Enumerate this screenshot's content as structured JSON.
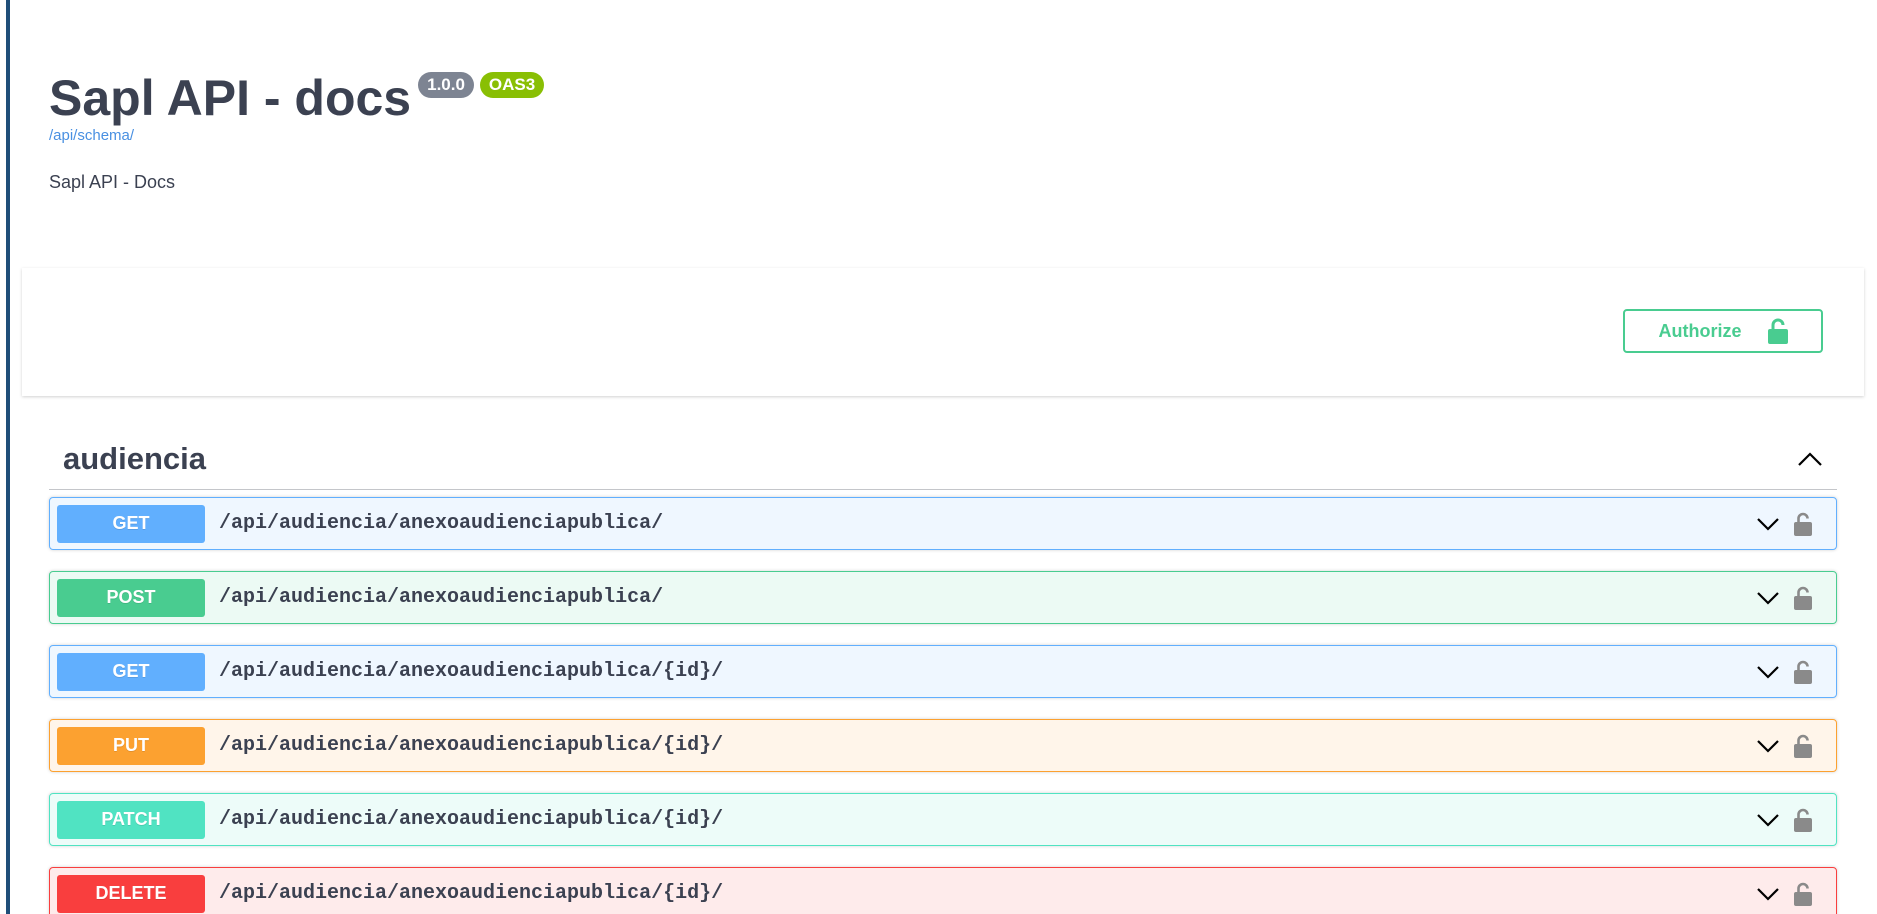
{
  "info": {
    "title": "Sapl API - docs",
    "version": "1.0.0",
    "oas_badge": "OAS3",
    "schema_url": "/api/schema/",
    "description": "Sapl API - Docs"
  },
  "authorize": {
    "label": "Authorize",
    "icon": "unlocked-padlock-icon",
    "color": "#49cc90"
  },
  "tag": {
    "name": "audiencia",
    "expanded": true
  },
  "operations": [
    {
      "method": "GET",
      "path": "/api/audiencia/anexoaudienciapublica/"
    },
    {
      "method": "POST",
      "path": "/api/audiencia/anexoaudienciapublica/"
    },
    {
      "method": "GET",
      "path": "/api/audiencia/anexoaudienciapublica/{id}/"
    },
    {
      "method": "PUT",
      "path": "/api/audiencia/anexoaudienciapublica/{id}/"
    },
    {
      "method": "PATCH",
      "path": "/api/audiencia/anexoaudienciapublica/{id}/"
    },
    {
      "method": "DELETE",
      "path": "/api/audiencia/anexoaudienciapublica/{id}/"
    }
  ],
  "colors": {
    "get": "#61affe",
    "post": "#49cc90",
    "put": "#fca130",
    "patch": "#50e3c2",
    "delete": "#f93e3e"
  }
}
